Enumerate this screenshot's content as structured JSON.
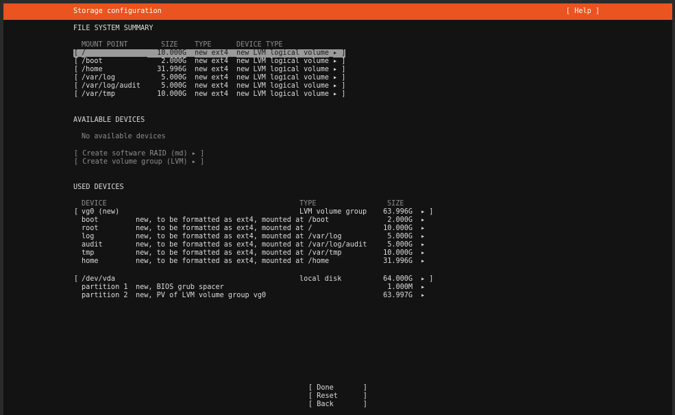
{
  "header": {
    "title": "Storage configuration",
    "help": "[ Help ]",
    "accent_color": "#e95420"
  },
  "fs_summary": {
    "heading": "FILE SYSTEM SUMMARY",
    "columns": {
      "mount_point": "MOUNT POINT",
      "size": "SIZE",
      "type": "TYPE",
      "device_type": "DEVICE TYPE"
    },
    "rows": [
      {
        "open": "[",
        "mount": "/",
        "size": "10.000G",
        "type": "new ext4",
        "device_type": "new LVM logical volume",
        "close": "▸ ]",
        "selected": true
      },
      {
        "open": "[",
        "mount": "/boot",
        "size": "2.000G",
        "type": "new ext4",
        "device_type": "new LVM logical volume",
        "close": "▸ ]"
      },
      {
        "open": "[",
        "mount": "/home",
        "size": "31.996G",
        "type": "new ext4",
        "device_type": "new LVM logical volume",
        "close": "▸ ]"
      },
      {
        "open": "[",
        "mount": "/var/log",
        "size": "5.000G",
        "type": "new ext4",
        "device_type": "new LVM logical volume",
        "close": "▸ ]"
      },
      {
        "open": "[",
        "mount": "/var/log/audit",
        "size": "5.000G",
        "type": "new ext4",
        "device_type": "new LVM logical volume",
        "close": "▸ ]"
      },
      {
        "open": "[",
        "mount": "/var/tmp",
        "size": "10.000G",
        "type": "new ext4",
        "device_type": "new LVM logical volume",
        "close": "▸ ]"
      }
    ]
  },
  "available": {
    "heading": "AVAILABLE DEVICES",
    "empty_text": "No available devices",
    "create_raid": "[ Create software RAID (md) ▸ ]",
    "create_vg": "[ Create volume group (LVM) ▸ ]"
  },
  "used": {
    "heading": "USED DEVICES",
    "columns": {
      "device": "DEVICE",
      "type": "TYPE",
      "size": "SIZE"
    },
    "vg0": {
      "open": "[",
      "name": "vg0 (new)",
      "type": "LVM volume group",
      "size": "63.996G",
      "close": "▸ ]",
      "children": [
        {
          "name": "boot",
          "desc": "new, to be formatted as ext4, mounted at /boot",
          "size": "2.000G",
          "arrow": "▸"
        },
        {
          "name": "root",
          "desc": "new, to be formatted as ext4, mounted at /",
          "size": "10.000G",
          "arrow": "▸"
        },
        {
          "name": "log",
          "desc": "new, to be formatted as ext4, mounted at /var/log",
          "size": "5.000G",
          "arrow": "▸"
        },
        {
          "name": "audit",
          "desc": "new, to be formatted as ext4, mounted at /var/log/audit",
          "size": "5.000G",
          "arrow": "▸"
        },
        {
          "name": "tmp",
          "desc": "new, to be formatted as ext4, mounted at /var/tmp",
          "size": "10.000G",
          "arrow": "▸"
        },
        {
          "name": "home",
          "desc": "new, to be formatted as ext4, mounted at /home",
          "size": "31.996G",
          "arrow": "▸"
        }
      ]
    },
    "vda": {
      "open": "[",
      "name": "/dev/vda",
      "type": "local disk",
      "size": "64.000G",
      "close": "▸ ]",
      "children": [
        {
          "name": "partition 1",
          "desc": "new, BIOS grub spacer",
          "size": "1.000M",
          "arrow": "▸"
        },
        {
          "name": "partition 2",
          "desc": "new, PV of LVM volume group vg0",
          "size": "63.997G",
          "arrow": "▸"
        }
      ]
    }
  },
  "footer": {
    "done": "[ Done       ]",
    "reset": "[ Reset      ]",
    "back": "[ Back       ]"
  }
}
